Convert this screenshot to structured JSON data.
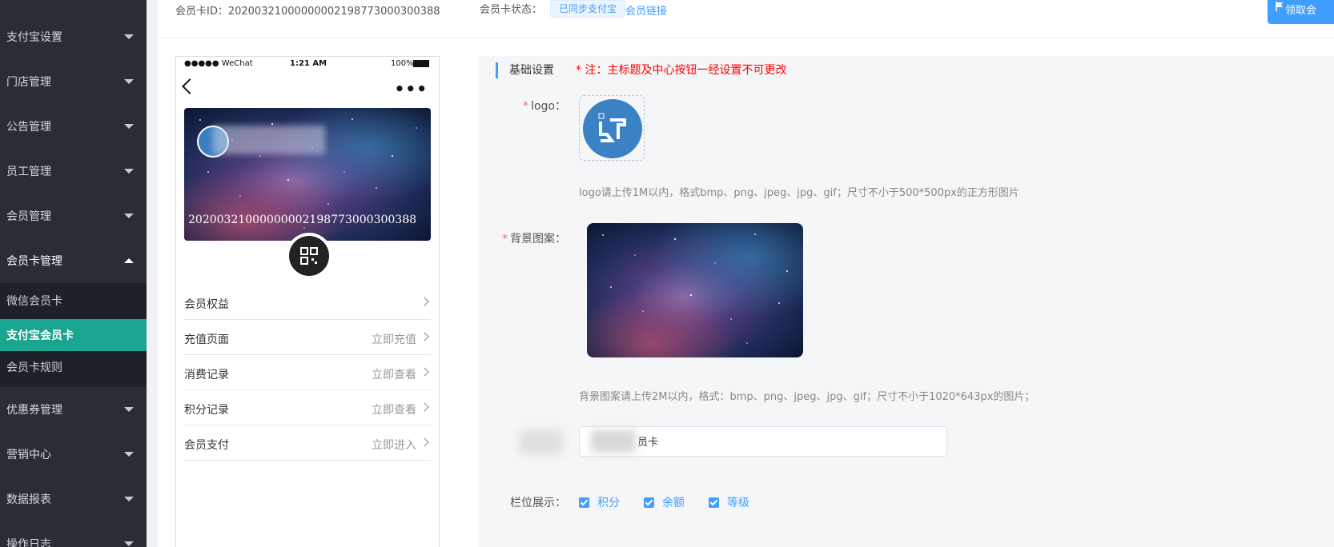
{
  "sidebar": {
    "items": [
      {
        "label": "支付宝设置"
      },
      {
        "label": "门店管理"
      },
      {
        "label": "公告管理"
      },
      {
        "label": "员工管理"
      },
      {
        "label": "会员管理"
      },
      {
        "label": "会员卡管理"
      },
      {
        "label": "优惠券管理"
      },
      {
        "label": "营销中心"
      },
      {
        "label": "数据报表"
      },
      {
        "label": "操作日志"
      }
    ],
    "sub_items": [
      {
        "label": "微信会员卡"
      },
      {
        "label": "支付宝会员卡"
      },
      {
        "label": "会员卡规则"
      }
    ],
    "active_sub": "支付宝会员卡",
    "accent_color": "#19a590"
  },
  "topbar": {
    "card_id": "会员卡ID：20200321000000002198773000300388",
    "status_label": "会员卡状态：",
    "status_tag": "已同步支付宝",
    "member_link": "会员链接",
    "receive_button": "领取会"
  },
  "phone": {
    "carrier": "●●●●● WeChat",
    "time": "1:21 AM",
    "battery": "100%",
    "more": "•••",
    "card_number": "20200321000000002198773000300388",
    "menu": [
      {
        "label": "会员权益",
        "action": ""
      },
      {
        "label": "充值页面",
        "action": "立即充值"
      },
      {
        "label": "消费记录",
        "action": "立即查看"
      },
      {
        "label": "积分记录",
        "action": "立即查看"
      },
      {
        "label": "会员支付",
        "action": "立即进入"
      }
    ]
  },
  "settings": {
    "section_title": "基础设置",
    "section_note": "*  注：主标题及中心按钮一经设置不可更改",
    "logo_label": "logo：",
    "logo_hint": "logo请上传1M以内，格式bmp、png、jpeg、jpg、gif；尺寸不小于500*500px的正方形图片",
    "bg_label": "背景图案：",
    "bg_hint": "背景图案请上传2M以内，格式：bmp、png、jpeg、jpg、gif；尺寸不小于1020*643px的图片；",
    "name_value": "员卡",
    "columns_label": "栏位展示：",
    "columns": [
      {
        "label": "积分",
        "checked": true
      },
      {
        "label": "余额",
        "checked": true
      },
      {
        "label": "等级",
        "checked": true
      }
    ],
    "primary_color": "#409eff"
  }
}
